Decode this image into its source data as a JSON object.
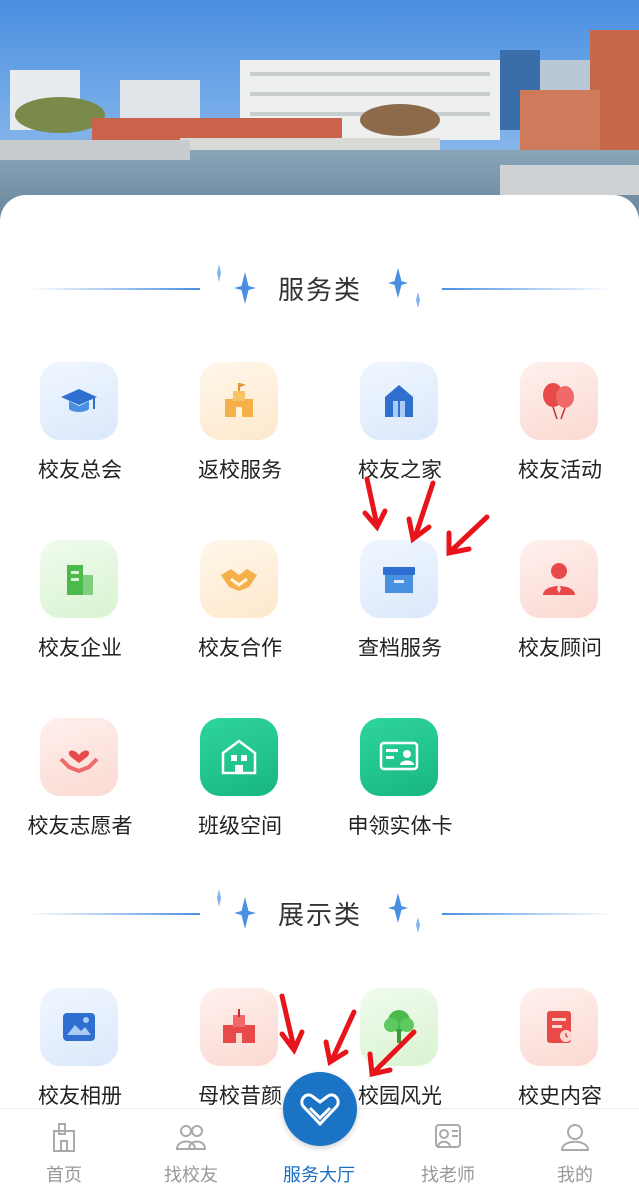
{
  "sections": {
    "services": {
      "title": "服务类"
    },
    "display": {
      "title": "展示类"
    }
  },
  "services": [
    {
      "label": "校友总会",
      "icon": "graduation-cap-icon"
    },
    {
      "label": "返校服务",
      "icon": "castle-icon"
    },
    {
      "label": "校友之家",
      "icon": "home-building-icon"
    },
    {
      "label": "校友活动",
      "icon": "balloons-icon"
    },
    {
      "label": "校友企业",
      "icon": "office-building-icon"
    },
    {
      "label": "校友合作",
      "icon": "handshake-icon"
    },
    {
      "label": "查档服务",
      "icon": "archive-box-icon"
    },
    {
      "label": "校友顾问",
      "icon": "person-advisor-icon"
    },
    {
      "label": "校友志愿者",
      "icon": "heart-hands-icon"
    },
    {
      "label": "班级空间",
      "icon": "classroom-icon"
    },
    {
      "label": "申领实体卡",
      "icon": "id-card-icon"
    }
  ],
  "display": [
    {
      "label": "校友相册",
      "icon": "photo-album-icon"
    },
    {
      "label": "母校昔颜",
      "icon": "school-building-icon"
    },
    {
      "label": "校园风光",
      "icon": "tree-icon"
    },
    {
      "label": "校史内容",
      "icon": "history-document-icon"
    }
  ],
  "tabbar": {
    "items": [
      {
        "label": "首页",
        "icon": "home-icon"
      },
      {
        "label": "找校友",
        "icon": "people-icon"
      },
      {
        "label": "服务大厅",
        "icon": "service-hall-icon",
        "active": true
      },
      {
        "label": "找老师",
        "icon": "teacher-icon"
      },
      {
        "label": "我的",
        "icon": "profile-icon"
      }
    ]
  },
  "colors": {
    "accent": "#1a6fc4",
    "annotation": "#e8141c"
  }
}
